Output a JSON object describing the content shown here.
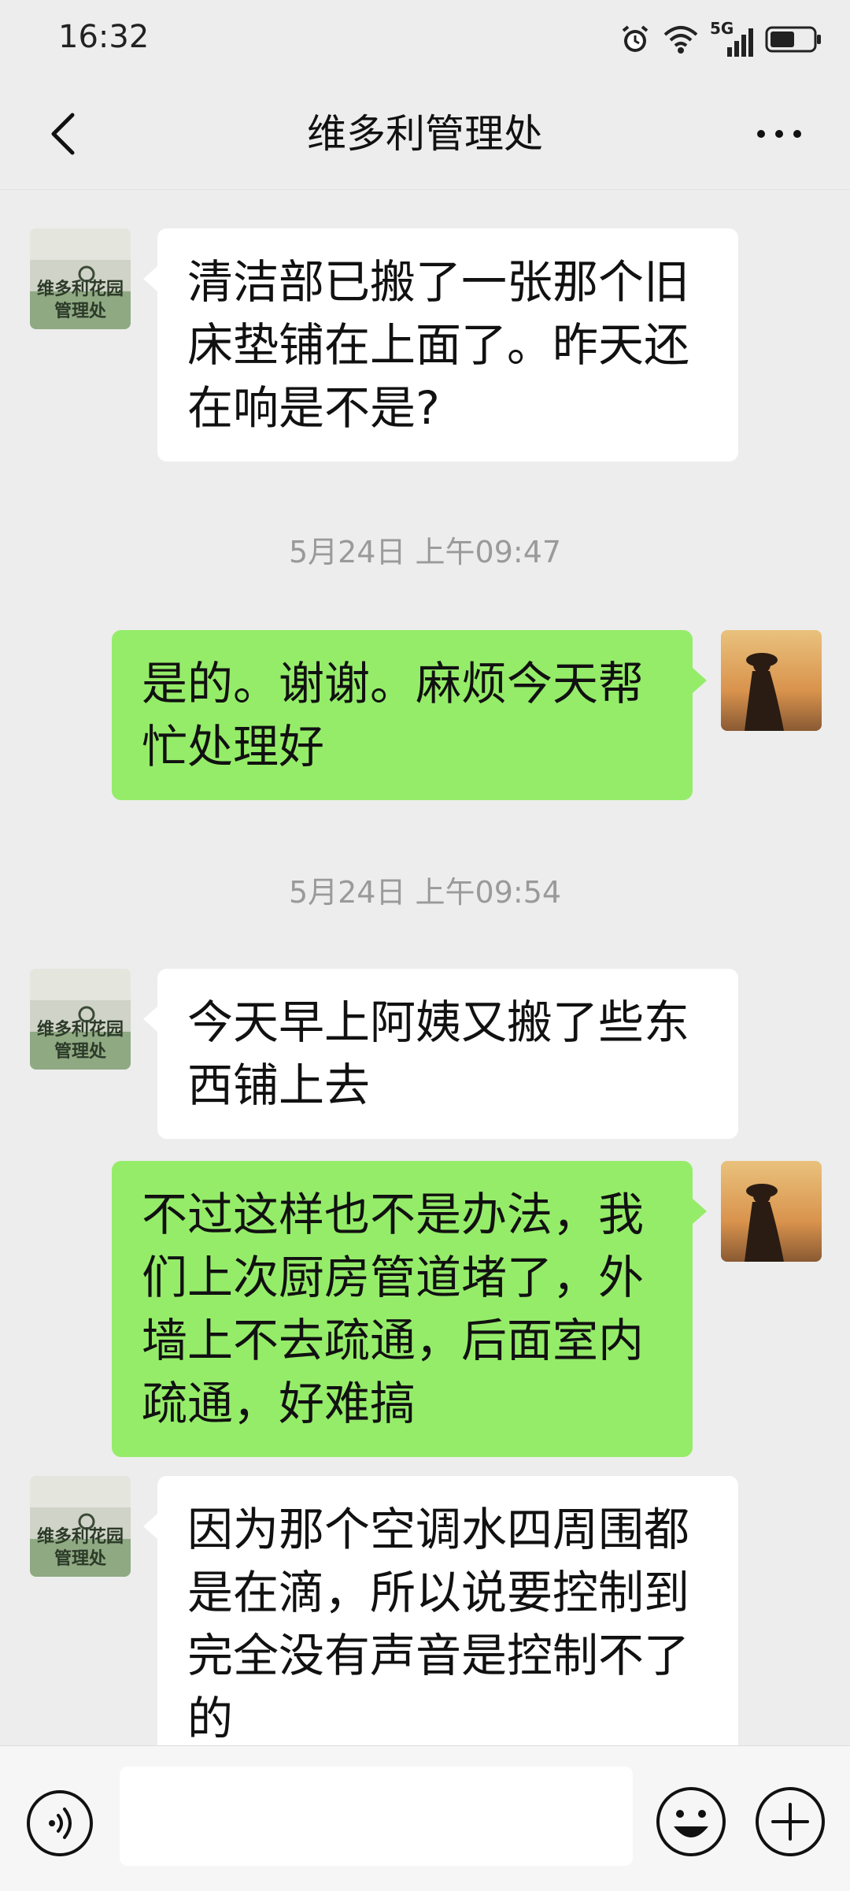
{
  "status": {
    "time": "16:32",
    "network": "5G"
  },
  "header": {
    "title": "维多利管理处"
  },
  "contact_avatar_text": [
    "维多利花园",
    "管理处"
  ],
  "messages": [
    {
      "side": "in",
      "text": "清洁部已搬了一张那个旧床垫铺在上面了。昨天还在响是不是?"
    },
    {
      "side": "out",
      "text": "是的。谢谢。麻烦今天帮忙处理好"
    },
    {
      "side": "in",
      "text": "今天早上阿姨又搬了些东西铺上去"
    },
    {
      "side": "out",
      "text": "不过这样也不是办法，我们上次厨房管道堵了，外墙上不去疏通，后面室内疏通，好难搞"
    },
    {
      "side": "in",
      "text": "因为那个空调水四周围都是在滴，所以说要控制到完全没有声音是控制不了的"
    }
  ],
  "timestamps": [
    "5月24日 上午09:47",
    "5月24日 上午09:54"
  ],
  "colors": {
    "outgoing_bubble": "#95ec69",
    "incoming_bubble": "#ffffff",
    "background": "#ededed"
  },
  "icons": {
    "status": [
      "alarm-icon",
      "wifi-icon",
      "signal-icon",
      "battery-icon"
    ],
    "nav": [
      "back-icon",
      "more-icon"
    ],
    "input": [
      "voice-icon",
      "emoji-icon",
      "plus-icon"
    ]
  }
}
